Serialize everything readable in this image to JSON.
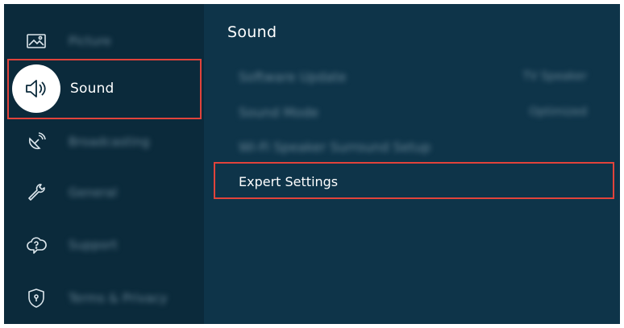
{
  "menu": {
    "items": [
      {
        "label": "Picture",
        "icon": "picture-icon"
      },
      {
        "label": "Sound",
        "icon": "speaker-icon"
      },
      {
        "label": "Broadcasting",
        "icon": "satellite-dish-icon"
      },
      {
        "label": "General",
        "icon": "wrench-icon"
      },
      {
        "label": "Support",
        "icon": "cloud-help-icon"
      },
      {
        "label": "Terms & Privacy",
        "icon": "shield-icon"
      }
    ],
    "selected": "Sound"
  },
  "panel": {
    "title": "Sound",
    "rows": [
      {
        "label": "Software Update",
        "value": "TV Speaker"
      },
      {
        "label": "Sound Mode",
        "value": "Optimized"
      },
      {
        "label": "Wi-Fi Speaker Surround Setup",
        "value": ""
      },
      {
        "label": "Expert Settings",
        "value": ""
      }
    ]
  },
  "colors": {
    "background": "#0e3449",
    "sidebar": "#0b2a3b",
    "highlight": "#e1433b",
    "text": "#ffffff"
  }
}
